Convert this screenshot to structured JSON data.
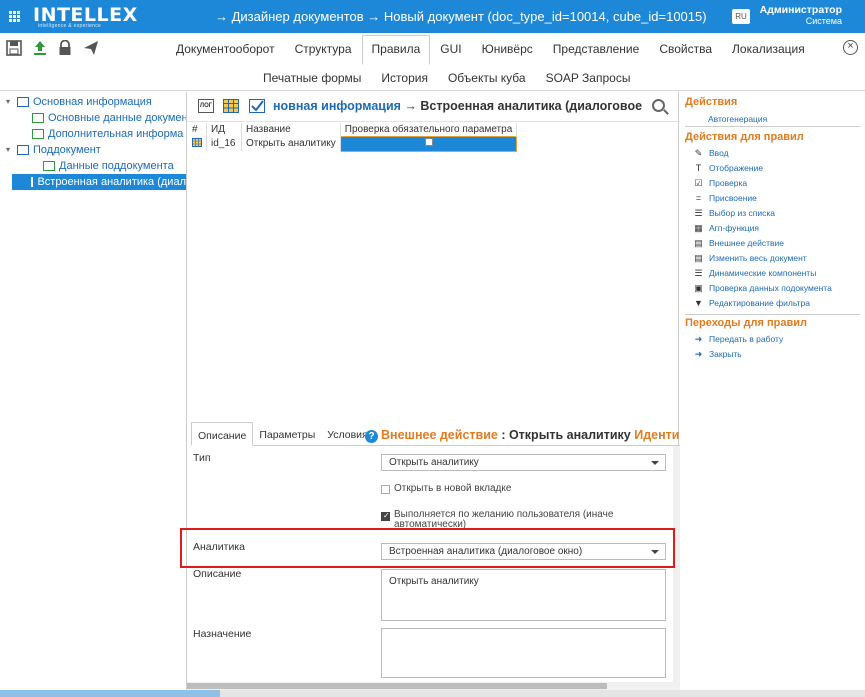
{
  "header": {
    "logo": "INTELLEX",
    "logo_tagline": "intelligence & experience",
    "breadcrumb": "→ Дизайнер документов → Новый документ (doc_type_id=10014, cube_id=10015)",
    "lang": "RU",
    "user_name": "Администратор",
    "user_role": "Система"
  },
  "toolbar": {
    "tools": [
      "save-icon",
      "upload-icon",
      "lock-icon",
      "send-icon"
    ],
    "tabs": [
      "Документооборот",
      "Структура",
      "Правила",
      "GUI",
      "Юнивёрс",
      "Представление",
      "Свойства",
      "Локализация"
    ],
    "active_tab": "Правила",
    "subtabs": [
      "Печатные формы",
      "История",
      "Объекты куба",
      "SOAP Запросы"
    ]
  },
  "tree": [
    {
      "label": "Основная информация",
      "level": 0,
      "toggle": "▾",
      "icon": "doc"
    },
    {
      "label": "Основные данные докумен",
      "level": 1,
      "icon": "doc"
    },
    {
      "label": "Дополнительная информа",
      "level": 1,
      "icon": "doc"
    },
    {
      "label": "Поддокумент",
      "level": 0,
      "toggle": "▾",
      "icon": "table"
    },
    {
      "label": "Данные поддокумента",
      "level": 2,
      "icon": "doc"
    },
    {
      "label": "Встроенная аналитика (диал",
      "level": 1,
      "icon": "doc",
      "selected": true
    }
  ],
  "center": {
    "head_icons": [
      "log-icon",
      "grid-icon",
      "check-icon"
    ],
    "head_log_label": "ЛОГ",
    "title_blue": "новная информация",
    "title_rest": " → Встроенная аналитика (диалоговое окно)",
    "columns": [
      "#",
      "ИД",
      "Название",
      "Проверка обязательного параметра"
    ],
    "rows": [
      {
        "id": "id_16",
        "name": "Открыть аналитику"
      }
    ]
  },
  "form": {
    "tabs": [
      "Описание",
      "Параметры",
      "Условия"
    ],
    "active_tab": "Описание",
    "title_orange": "Внешнее действие",
    "title_rest": " : Открыть аналитику ",
    "title_orange2": "Идентифика",
    "type_label": "Тип",
    "type_value": "Открыть аналитику",
    "new_tab_label": "Открыть в новой вкладке",
    "optional_label": "Выполняется по желанию пользователя (иначе",
    "optional_label2": "автоматически)",
    "analytics_label": "Аналитика",
    "analytics_value": "Встроенная аналитика (диалоговое окно)",
    "desc_label": "Описание",
    "desc_value": "Открыть аналитику",
    "purpose_label": "Назначение",
    "purpose_value": ""
  },
  "right": {
    "actions_title": "Действия",
    "actions": [
      {
        "label": "Автогенерация",
        "icon": "list-icon"
      }
    ],
    "rule_actions_title": "Действия для правил",
    "rule_actions": [
      {
        "label": "Ввод",
        "icon": "pencil-icon",
        "glyph": "✎"
      },
      {
        "label": "Отображение",
        "icon": "text-icon",
        "glyph": "T"
      },
      {
        "label": "Проверка",
        "icon": "check-icon",
        "glyph": "☑"
      },
      {
        "label": "Присвоение",
        "icon": "equals-icon",
        "glyph": "="
      },
      {
        "label": "Выбор из списка",
        "icon": "list-icon",
        "glyph": "☰"
      },
      {
        "label": "Агп-функция",
        "icon": "function-icon",
        "glyph": "▦"
      },
      {
        "label": "Внешнее действие",
        "icon": "external-icon",
        "glyph": "▤"
      },
      {
        "label": "Изменить весь документ",
        "icon": "document-icon",
        "glyph": "▤"
      },
      {
        "label": "Динамические компоненты",
        "icon": "list-icon",
        "glyph": "☰"
      },
      {
        "label": "Проверка данных подокумента",
        "icon": "table-check-icon",
        "glyph": "▣"
      },
      {
        "label": "Редактирование фильтра",
        "icon": "filter-icon",
        "glyph": "▼"
      }
    ],
    "transitions_title": "Переходы для правил",
    "transitions": [
      {
        "label": "Передать в работу",
        "icon": "arrow-icon",
        "glyph": "➜"
      },
      {
        "label": "Закрыть",
        "icon": "arrow-icon",
        "glyph": "➜"
      }
    ]
  }
}
